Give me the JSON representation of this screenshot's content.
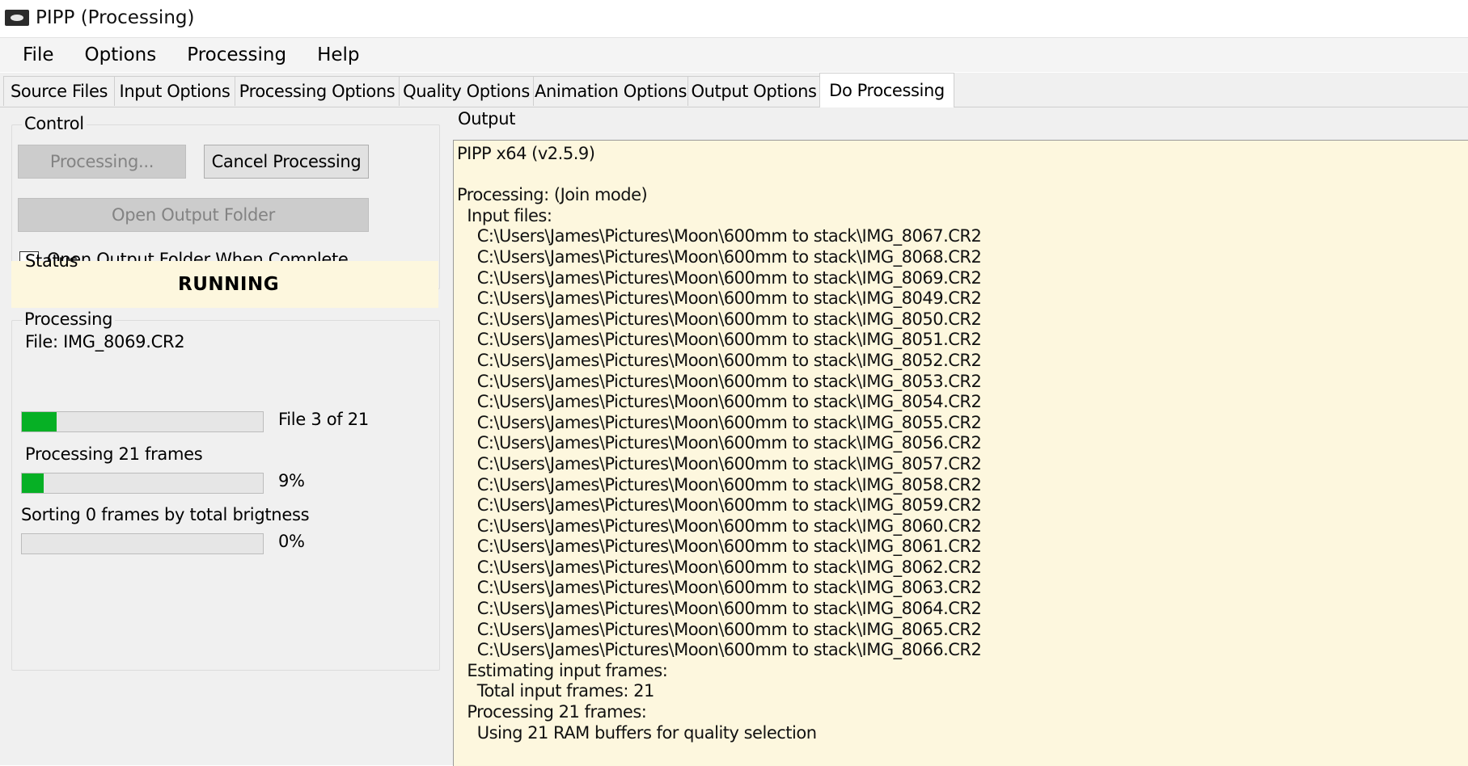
{
  "window": {
    "title": "PIPP (Processing)"
  },
  "menu": [
    "File",
    "Options",
    "Processing",
    "Help"
  ],
  "tabs": [
    {
      "label": "Source Files"
    },
    {
      "label": "Input Options"
    },
    {
      "label": "Processing Options"
    },
    {
      "label": "Quality Options"
    },
    {
      "label": "Animation Options"
    },
    {
      "label": "Output Options"
    },
    {
      "label": "Do Processing"
    }
  ],
  "control": {
    "group_title": "Control",
    "processing_button": "Processing...",
    "cancel_button": "Cancel Processing",
    "open_folder_button": "Open Output Folder",
    "open_when_complete_label": "Open Output Folder When Complete",
    "open_when_complete_checked": false
  },
  "status": {
    "group_title": "Status",
    "value": "RUNNING"
  },
  "processing": {
    "group_title": "Processing",
    "file_label": "File: IMG_8069.CR2",
    "file_progress_text": "File 3 of 21",
    "file_progress": 0.143,
    "frames_label": "Processing 21 frames",
    "frames_progress_text": "9%",
    "frames_progress": 0.09,
    "sort_label": "Sorting 0 frames by total brigtness",
    "sort_progress_text": "0%",
    "sort_progress": 0.0
  },
  "output": {
    "group_title": "Output",
    "lines": [
      "PIPP x64 (v2.5.9)",
      "",
      "Processing: (Join mode)",
      "  Input files:",
      "    C:\\Users\\James\\Pictures\\Moon\\600mm to stack\\IMG_8067.CR2",
      "    C:\\Users\\James\\Pictures\\Moon\\600mm to stack\\IMG_8068.CR2",
      "    C:\\Users\\James\\Pictures\\Moon\\600mm to stack\\IMG_8069.CR2",
      "    C:\\Users\\James\\Pictures\\Moon\\600mm to stack\\IMG_8049.CR2",
      "    C:\\Users\\James\\Pictures\\Moon\\600mm to stack\\IMG_8050.CR2",
      "    C:\\Users\\James\\Pictures\\Moon\\600mm to stack\\IMG_8051.CR2",
      "    C:\\Users\\James\\Pictures\\Moon\\600mm to stack\\IMG_8052.CR2",
      "    C:\\Users\\James\\Pictures\\Moon\\600mm to stack\\IMG_8053.CR2",
      "    C:\\Users\\James\\Pictures\\Moon\\600mm to stack\\IMG_8054.CR2",
      "    C:\\Users\\James\\Pictures\\Moon\\600mm to stack\\IMG_8055.CR2",
      "    C:\\Users\\James\\Pictures\\Moon\\600mm to stack\\IMG_8056.CR2",
      "    C:\\Users\\James\\Pictures\\Moon\\600mm to stack\\IMG_8057.CR2",
      "    C:\\Users\\James\\Pictures\\Moon\\600mm to stack\\IMG_8058.CR2",
      "    C:\\Users\\James\\Pictures\\Moon\\600mm to stack\\IMG_8059.CR2",
      "    C:\\Users\\James\\Pictures\\Moon\\600mm to stack\\IMG_8060.CR2",
      "    C:\\Users\\James\\Pictures\\Moon\\600mm to stack\\IMG_8061.CR2",
      "    C:\\Users\\James\\Pictures\\Moon\\600mm to stack\\IMG_8062.CR2",
      "    C:\\Users\\James\\Pictures\\Moon\\600mm to stack\\IMG_8063.CR2",
      "    C:\\Users\\James\\Pictures\\Moon\\600mm to stack\\IMG_8064.CR2",
      "    C:\\Users\\James\\Pictures\\Moon\\600mm to stack\\IMG_8065.CR2",
      "    C:\\Users\\James\\Pictures\\Moon\\600mm to stack\\IMG_8066.CR2",
      "  Estimating input frames:",
      "    Total input frames: 21",
      "  Processing 21 frames:",
      "    Using 21 RAM buffers for quality selection"
    ]
  },
  "colors": {
    "progress_green": "#06b025",
    "output_background": "#fdf7de",
    "status_background": "#fdf7de"
  }
}
